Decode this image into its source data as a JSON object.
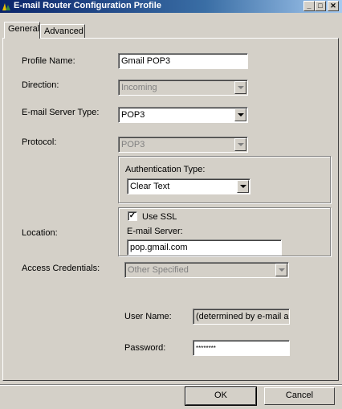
{
  "window": {
    "title": "E-mail Router Configuration Profile",
    "controls": [
      "minimize",
      "maximize",
      "close"
    ]
  },
  "tabs": {
    "general": "General",
    "advanced": "Advanced"
  },
  "form": {
    "profile_name_label": "Profile Name:",
    "profile_name_value": "Gmail POP3",
    "direction_label": "Direction:",
    "direction_value": "Incoming",
    "server_type_label": "E-mail Server Type:",
    "server_type_value": "POP3",
    "protocol_label": "Protocol:",
    "protocol_value": "POP3",
    "auth_group_label": "Authentication Type:",
    "auth_type_value": "Clear Text",
    "use_ssl_label": "Use SSL",
    "use_ssl_checked": true,
    "location_label": "Location:",
    "email_server_label": "E-mail Server:",
    "email_server_value": "pop.gmail.com",
    "access_credentials_label": "Access Credentials:",
    "access_credentials_value": "Other Specified",
    "user_name_label": "User Name:",
    "user_name_value": "(determined by e-mail addre",
    "password_label": "Password:",
    "password_value": "********"
  },
  "buttons": {
    "ok": "OK",
    "cancel": "Cancel"
  }
}
